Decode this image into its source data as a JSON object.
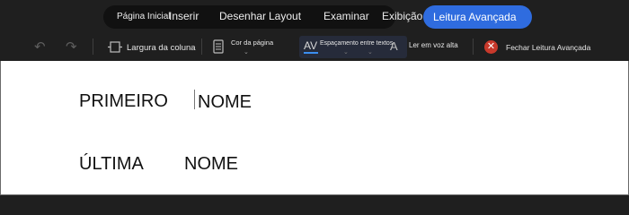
{
  "ribbon": {
    "tabs": [
      {
        "label": "Página Inicial"
      },
      {
        "label": "Inserir"
      },
      {
        "label": "Desenhar"
      },
      {
        "label": "Layout"
      },
      {
        "label": "Examinar"
      },
      {
        "label": "Exibição"
      }
    ],
    "active_tab": {
      "label": "Leitura Avançada"
    }
  },
  "toolbar": {
    "column_width_label": "Largura da coluna",
    "page_color_label": "Cor da página",
    "text_spacing_label": "Espaçamento entre textos",
    "text_spacing_glyph": "AV",
    "read_aloud_label": "Ler em voz alta",
    "close_label": "Fechar Leitura Avançada",
    "colors": {
      "close": "#c8392b",
      "active_tab": "#2f6cdf"
    }
  },
  "document": {
    "line1_a": "PRIMEIRO",
    "line1_b": "NOME",
    "line2_a": "ÚLTIMA",
    "line2_b": "NOME"
  }
}
